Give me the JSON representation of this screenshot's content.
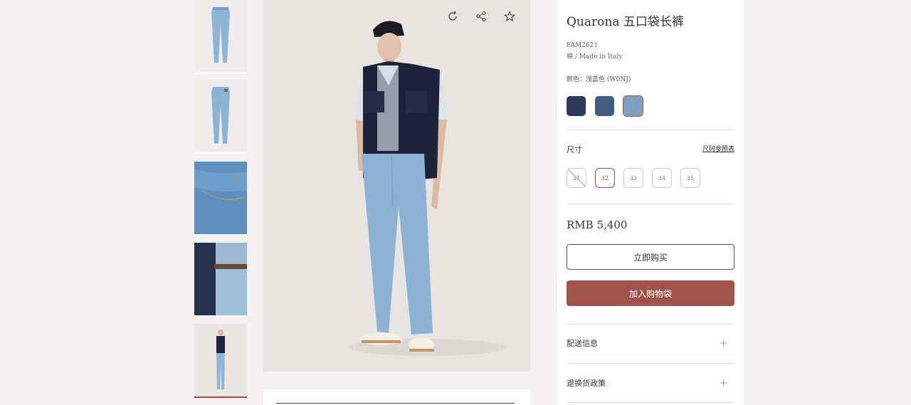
{
  "product": {
    "title": "Quarona 五口袋长裤",
    "sku": "FAM2621",
    "material": "棉 / Made in Italy",
    "color_label": "颜色：浅蓝色 (W0NJ)",
    "price": "RMB 5,400"
  },
  "swatches": [
    {
      "color": "#2b3a5c",
      "selected": false
    },
    {
      "color": "#3f5d80",
      "selected": false
    },
    {
      "color": "#7ba2c2",
      "selected": true
    }
  ],
  "sizes": {
    "label": "尺寸",
    "guide_link": "尺码参照表",
    "options": [
      {
        "value": "31",
        "state": "disabled"
      },
      {
        "value": "32",
        "state": "selected"
      },
      {
        "value": "33",
        "state": "available"
      },
      {
        "value": "34",
        "state": "available"
      },
      {
        "value": "35",
        "state": "available"
      }
    ]
  },
  "buttons": {
    "buy_now": "立即购买",
    "add_to_bag": "加入购物袋"
  },
  "accordion": [
    {
      "label": "配送信息",
      "icon": "+"
    },
    {
      "label": "退换货政策",
      "icon": "+"
    }
  ],
  "image_tools": [
    "rotate-icon",
    "share-icon",
    "star-icon"
  ],
  "thumbnails": [
    {
      "name": "thumb-front-jeans",
      "active": false
    },
    {
      "name": "thumb-back-jeans",
      "active": false
    },
    {
      "name": "thumb-pocket-detail",
      "active": false
    },
    {
      "name": "thumb-waist-detail",
      "active": false
    },
    {
      "name": "thumb-model-full",
      "active": true
    }
  ],
  "colors": {
    "accent": "#a0534b",
    "background": "#f3f1f1"
  }
}
